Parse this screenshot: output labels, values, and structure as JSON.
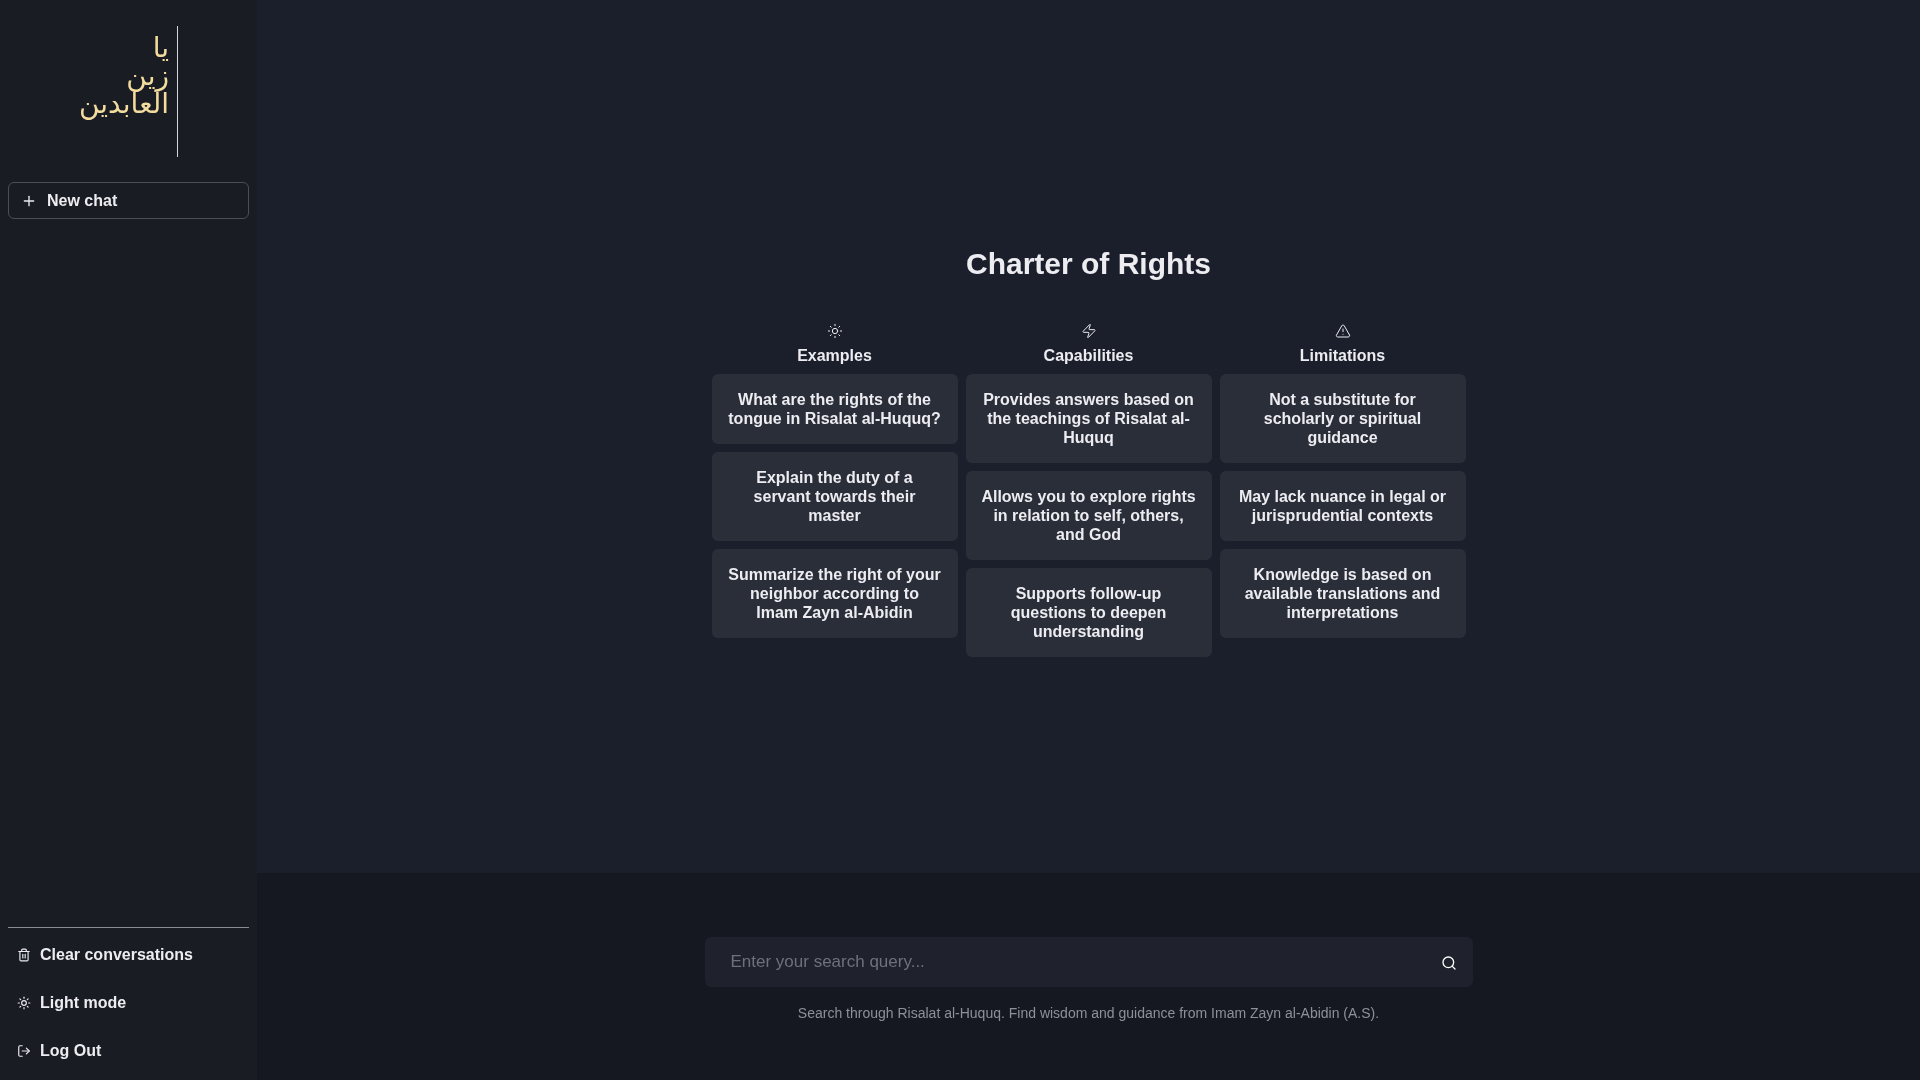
{
  "sidebar": {
    "logo_lines": [
      "يا",
      "زين",
      "العابدين"
    ],
    "new_chat": "New chat",
    "actions": [
      {
        "kind": "clear",
        "label": "Clear conversations"
      },
      {
        "kind": "theme",
        "label": "Light mode"
      },
      {
        "kind": "logout",
        "label": "Log Out"
      }
    ]
  },
  "main": {
    "title": "Charter of Rights",
    "columns": [
      {
        "kind": "examples",
        "heading": "Examples",
        "items": [
          "What are the rights of the tongue in Risalat al-Huquq?",
          "Explain the duty of a servant towards their master",
          "Summarize the right of your neighbor according to Imam Zayn al-Abidin"
        ]
      },
      {
        "kind": "capabilities",
        "heading": "Capabilities",
        "items": [
          "Provides answers based on the teachings of Risalat al-Huquq",
          "Allows you to explore rights in relation to self, others, and God",
          "Supports follow-up questions to deepen understanding"
        ]
      },
      {
        "kind": "limitations",
        "heading": "Limitations",
        "items": [
          "Not a substitute for scholarly or spiritual guidance",
          "May lack nuance in legal or jurisprudential contexts",
          "Knowledge is based on available translations and interpretations"
        ]
      }
    ]
  },
  "search": {
    "placeholder": "Enter your search query...",
    "caption": "Search through Risalat al-Huquq. Find wisdom and guidance from Imam Zayn al-Abidin (A.S)."
  }
}
